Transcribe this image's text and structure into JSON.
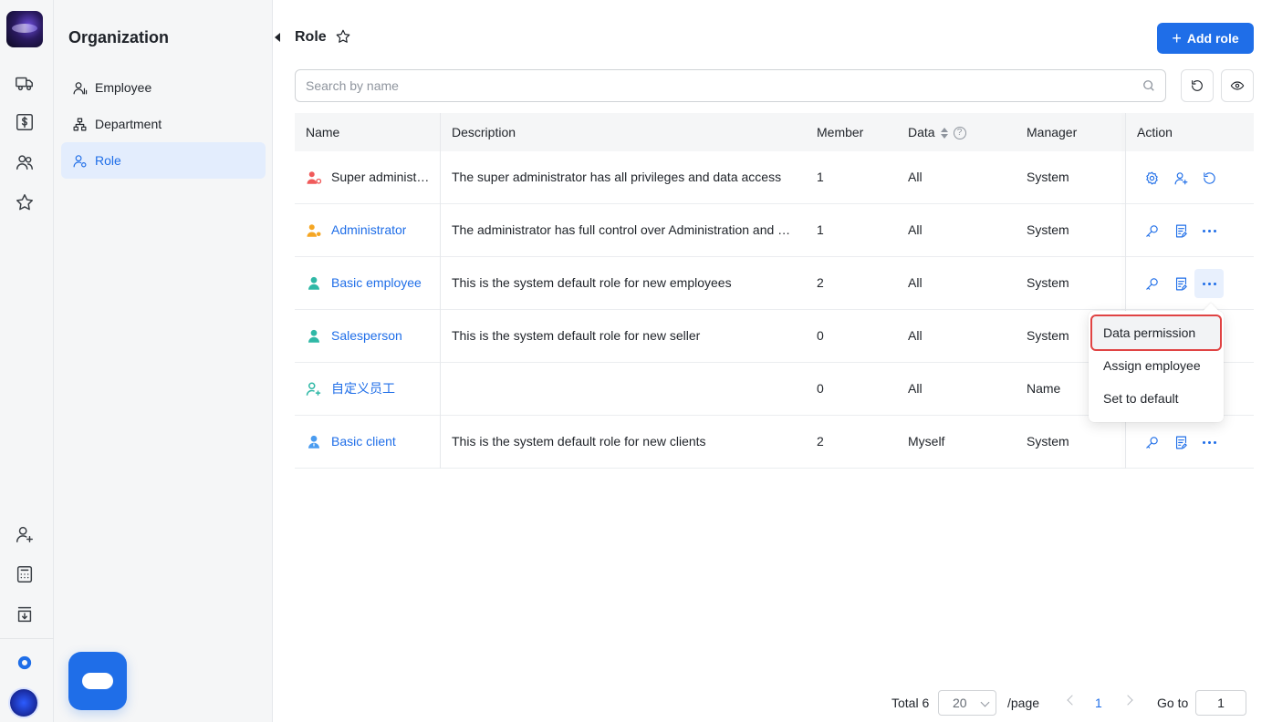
{
  "sidebar": {
    "title": "Organization",
    "items": [
      {
        "label": "Employee"
      },
      {
        "label": "Department"
      },
      {
        "label": "Role"
      }
    ]
  },
  "header": {
    "title": "Role",
    "add_label": "Add role"
  },
  "search": {
    "placeholder": "Search by name"
  },
  "table": {
    "columns": {
      "name": "Name",
      "description": "Description",
      "member": "Member",
      "data": "Data",
      "manager": "Manager",
      "action": "Action"
    },
    "rows": [
      {
        "name": "Super administ…",
        "description": "The super administrator has all privileges and data access",
        "member": "1",
        "data": "All",
        "manager": "System"
      },
      {
        "name": "Administrator",
        "description": "The administrator has full control over Administration and …",
        "member": "1",
        "data": "All",
        "manager": "System"
      },
      {
        "name": "Basic employee",
        "description": "This is the system default role for new employees",
        "member": "2",
        "data": "All",
        "manager": "System"
      },
      {
        "name": "Salesperson",
        "description": "This is the system default role for new seller",
        "member": "0",
        "data": "All",
        "manager": "System"
      },
      {
        "name": "自定义员工",
        "description": "",
        "member": "0",
        "data": "All",
        "manager": "Name"
      },
      {
        "name": "Basic client",
        "description": "This is the system default role for new clients",
        "member": "2",
        "data": "Myself",
        "manager": "System"
      }
    ]
  },
  "dropdown": {
    "items": [
      {
        "label": "Data permission"
      },
      {
        "label": "Assign employee"
      },
      {
        "label": "Set to default"
      }
    ]
  },
  "pagination": {
    "total": "Total 6",
    "page_size": "20",
    "per_page": "/page",
    "current": "1",
    "goto_label": "Go to",
    "goto_value": "1"
  },
  "colors": {
    "accent": "#1f6ee8",
    "super_admin_icon": "#f05a5a",
    "admin_icon": "#f5a623",
    "employee_icon": "#2fb8a6",
    "client_icon": "#4a9cf0",
    "highlight": "#e04343"
  }
}
